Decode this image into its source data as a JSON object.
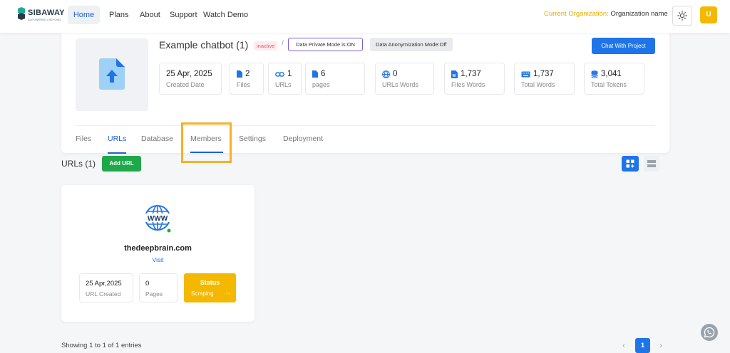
{
  "brand": {
    "name": "SIBAWAY",
    "tagline": "AI-POWERED • BEYOND"
  },
  "nav": {
    "home": "Home",
    "plans": "Plans",
    "about": "About",
    "support": "Support",
    "watch_demo": "Watch Demo"
  },
  "org": {
    "label": "Current Organization:",
    "value": "Organization name"
  },
  "user": {
    "initial": "U"
  },
  "project": {
    "title": "Example chatbot (1)",
    "status": "inactive",
    "separator": "/",
    "private_mode": "Data Private Mode is:ON",
    "anonymization_mode": "Data Anonymization Mode:Off",
    "chat_button": "Chat With Project",
    "stats": [
      {
        "value": "25 Apr, 2025",
        "label": "Created Date",
        "icon": ""
      },
      {
        "value": "2",
        "label": "Files",
        "icon": "file-icon"
      },
      {
        "value": "1",
        "label": "URLs",
        "icon": "link-icon"
      },
      {
        "value": "6",
        "label": "pages",
        "icon": "page-icon"
      },
      {
        "value": "0",
        "label": "URLs Words",
        "icon": "globe-icon"
      },
      {
        "value": "1,737",
        "label": "Files Words",
        "icon": "word-file-icon"
      },
      {
        "value": "1,737",
        "label": "Total Words",
        "icon": "keyboard-icon"
      },
      {
        "value": "3,041",
        "label": "Total Tokens",
        "icon": "database-icon"
      }
    ],
    "tabs": [
      "Files",
      "URLs",
      "Database",
      "Members",
      "Settings",
      "Deployment"
    ],
    "active_tab": "URLs"
  },
  "urls": {
    "title": "URLs (1)",
    "add_button": "Add URL",
    "card": {
      "name": "thedeepbrain.com",
      "visit": "Visit",
      "created_value": "25 Apr,2025",
      "created_label": "URL Created",
      "pages_value": "0",
      "pages_label": "Pages",
      "status_title": "Status",
      "status_value": "Scraping",
      "status_arrow": "→"
    }
  },
  "pagination": {
    "showing": "Showing 1 to 1 of 1 entries",
    "prev": "‹",
    "page": "1",
    "next": "›"
  },
  "colors": {
    "primary": "#1f75e8",
    "success": "#1ea84a",
    "warning": "#f5b800",
    "highlight": "#f5b128"
  }
}
